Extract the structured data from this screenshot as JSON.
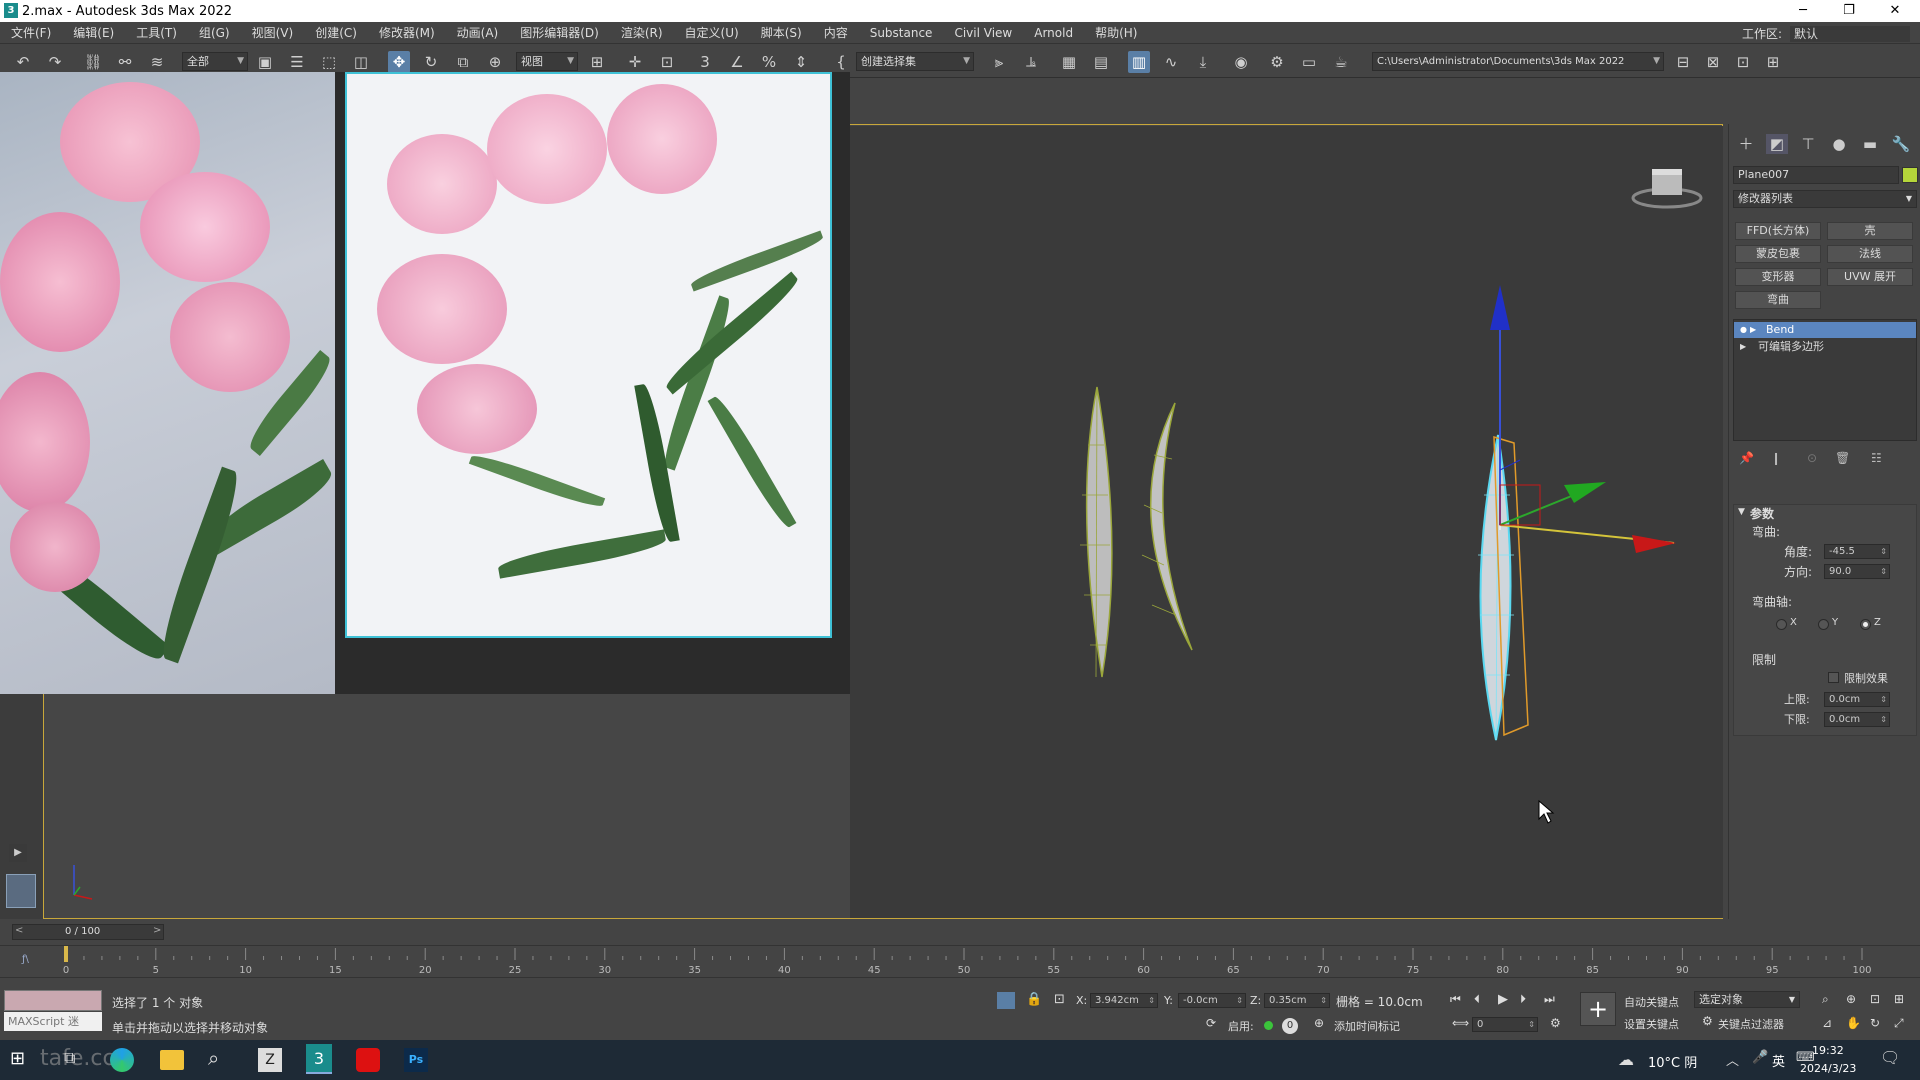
{
  "window": {
    "title": "2.max - Autodesk 3ds Max 2022",
    "app_icon_text": "3",
    "minimize": "─",
    "restore": "❐",
    "close": "✕"
  },
  "menu": [
    "文件(F)",
    "编辑(E)",
    "工具(T)",
    "组(G)",
    "视图(V)",
    "创建(C)",
    "修改器(M)",
    "动画(A)",
    "图形编辑器(D)",
    "渲染(R)",
    "自定义(U)",
    "脚本(S)",
    "内容",
    "Substance",
    "Civil View",
    "Arnold",
    "帮助(H)"
  ],
  "workspace": {
    "label": "工作区:",
    "value": "默认"
  },
  "toolbar": {
    "filter_value": "全部",
    "view_value": "视图",
    "selection_set_placeholder": "创建选择集",
    "path": "C:\\Users\\Administrator\\Documents\\3ds Max 2022"
  },
  "command_panel": {
    "object_name": "Plane007",
    "object_color": "#b5d63a",
    "modifier_list": "修改器列表",
    "buttons": [
      "FFD(长方体)",
      "壳",
      "蒙皮包裹",
      "法线",
      "变形器",
      "UVW 展开",
      "弯曲"
    ],
    "stack": [
      {
        "label": "Bend",
        "selected": true
      },
      {
        "label": "可编辑多边形",
        "selected": false
      }
    ],
    "params": {
      "section_title": "参数",
      "bend_label": "弯曲:",
      "angle_label": "角度:",
      "angle_value": "-45.5",
      "direction_label": "方向:",
      "direction_value": "90.0",
      "axis_label": "弯曲轴:",
      "axes": [
        "X",
        "Y",
        "Z"
      ],
      "axis_selected": "Z",
      "limits_label": "限制",
      "limit_effect_label": "限制效果",
      "upper_label": "上限:",
      "upper_value": "0.0cm",
      "lower_label": "下限:",
      "lower_value": "0.0cm"
    }
  },
  "timeline": {
    "frame_display": "0 / 100",
    "ticks": [
      "0",
      "5",
      "10",
      "15",
      "20",
      "25",
      "30",
      "35",
      "40",
      "45",
      "50",
      "55",
      "60",
      "65",
      "70",
      "75",
      "80",
      "85",
      "90",
      "95",
      "100"
    ],
    "current_frame": 0
  },
  "status": {
    "selection_text": "选择了 1 个 对象",
    "hint_text": "单击并拖动以选择并移动对象",
    "maxscript_label": "MAXScript 迷",
    "x_label": "X:",
    "x_value": "3.942cm",
    "y_label": "Y:",
    "y_value": "-0.0cm",
    "z_label": "Z:",
    "z_value": "0.35cm",
    "grid_text": "栅格 = 10.0cm",
    "enable_label": "启用:",
    "add_time_tag": "添加时间标记",
    "auto_key": "自动关键点",
    "set_key": "设置关键点",
    "selected_object": "选定对象",
    "key_filter": "关键点过滤器",
    "frame_value": "0"
  },
  "taskbar": {
    "weather": "10°C 阴",
    "ime": "英",
    "time": "19:32",
    "date": "2024/3/23",
    "watermark": "tafe.cc"
  }
}
